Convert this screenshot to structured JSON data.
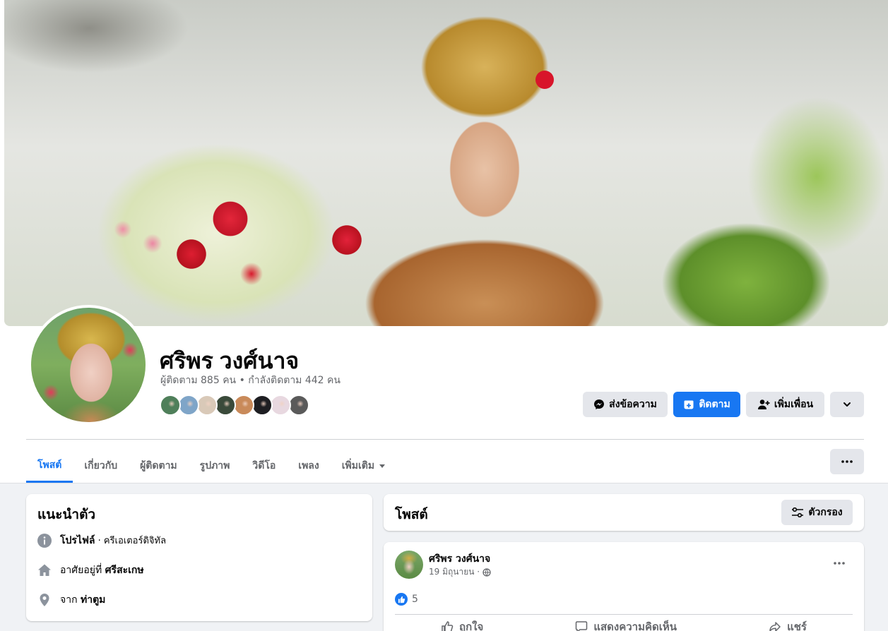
{
  "profile": {
    "name": "ศริพร วงศ์นาจ",
    "followers_text": "ผู้ติดตาม 885 คน • กำลังติดตาม 442 คน",
    "friend_avatar_colors": [
      "#4f7f5a",
      "#7fa5c8",
      "#d9c9b8",
      "#3a4a3a",
      "#c98a5a",
      "#1e1e22",
      "#e8d8e0",
      "#5a5a5a"
    ]
  },
  "actions": {
    "message": "ส่งข้อความ",
    "follow": "ติดตาม",
    "add_friend": "เพิ่มเพื่อน"
  },
  "tabs": [
    {
      "label": "โพสต์",
      "active": true
    },
    {
      "label": "เกี่ยวกับ"
    },
    {
      "label": "ผู้ติดตาม"
    },
    {
      "label": "รูปภาพ"
    },
    {
      "label": "วิดีโอ"
    },
    {
      "label": "เพลง"
    },
    {
      "label": "เพิ่มเติม"
    }
  ],
  "intro": {
    "title": "แนะนำตัว",
    "profile_label": "โปรไฟล์",
    "profile_value": " · ครีเอเตอร์ดิจิทัล",
    "lives_prefix": "อาศัยอยู่ที่ ",
    "lives_value": "ศรีสะเกษ",
    "from_prefix": "จาก ",
    "from_value": "ท่าตูม"
  },
  "posts": {
    "title": "โพสต์",
    "filter_label": "ตัวกรอง",
    "items": [
      {
        "author": "ศริพร วงศ์นาจ",
        "date": "19 มิถุนายน ·",
        "like_count": "5",
        "like_label": "ถูกใจ",
        "comment_label": "แสดงความคิดเห็น",
        "share_label": "แชร์"
      }
    ]
  },
  "colors": {
    "accent": "#1877f2",
    "button_grey": "#e4e6eb",
    "text_muted": "#65676b",
    "feed_bg": "#f0f2f5"
  }
}
